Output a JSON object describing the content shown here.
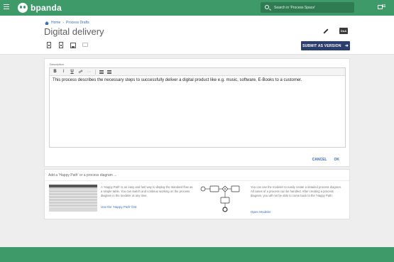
{
  "app": {
    "name": "bpanda",
    "notification_count": "11"
  },
  "search": {
    "placeholder": "Search in 'Process Space'"
  },
  "breadcrumb": [
    {
      "label": "Home"
    },
    {
      "label": "Process Drafts"
    }
  ],
  "page": {
    "title": "Digital delivery",
    "dna_label": "DnA"
  },
  "toolbar": {
    "submit_label": "SUBMIT AS VERSION"
  },
  "description": {
    "label": "Description",
    "text": "This process describes the necessary steps to successfully deliver a digital product like e.g. music, software, E-Books to a customer.",
    "cancel_label": "CANCEL",
    "ok_label": "OK"
  },
  "choice": {
    "title": "Add a 'Happy Path' or a process diagram ...",
    "happy_path_text": "A 'Happy Path' is an easy and fast way to display the standard flow as a simple table. You can switch and continue working on the process diagram in the modeler at any time.",
    "happy_path_link": "Use the 'Happy Path' first",
    "modeler_text": "You can use the modeler to easily create a detailed process diagram. All cases of a process can be handled. After creating a process diagram, you will not be able to come back to the 'Happy Path'.",
    "modeler_link": "Open Modeler"
  },
  "colors": {
    "brand": "#3e9a68",
    "submit": "#2c3e6b",
    "link": "#3b6fb5"
  },
  "icons": [
    "menu-icon",
    "panda-logo-icon",
    "search-icon",
    "notification-icon",
    "home-icon",
    "edit-icon",
    "dna-icon",
    "document-icon",
    "document-settings-icon",
    "save-icon",
    "comment-icon",
    "arrow-right-icon",
    "bold-icon",
    "italic-icon",
    "underline-icon",
    "link-icon",
    "unlink-icon",
    "bullet-list-icon",
    "numbered-list-icon"
  ]
}
